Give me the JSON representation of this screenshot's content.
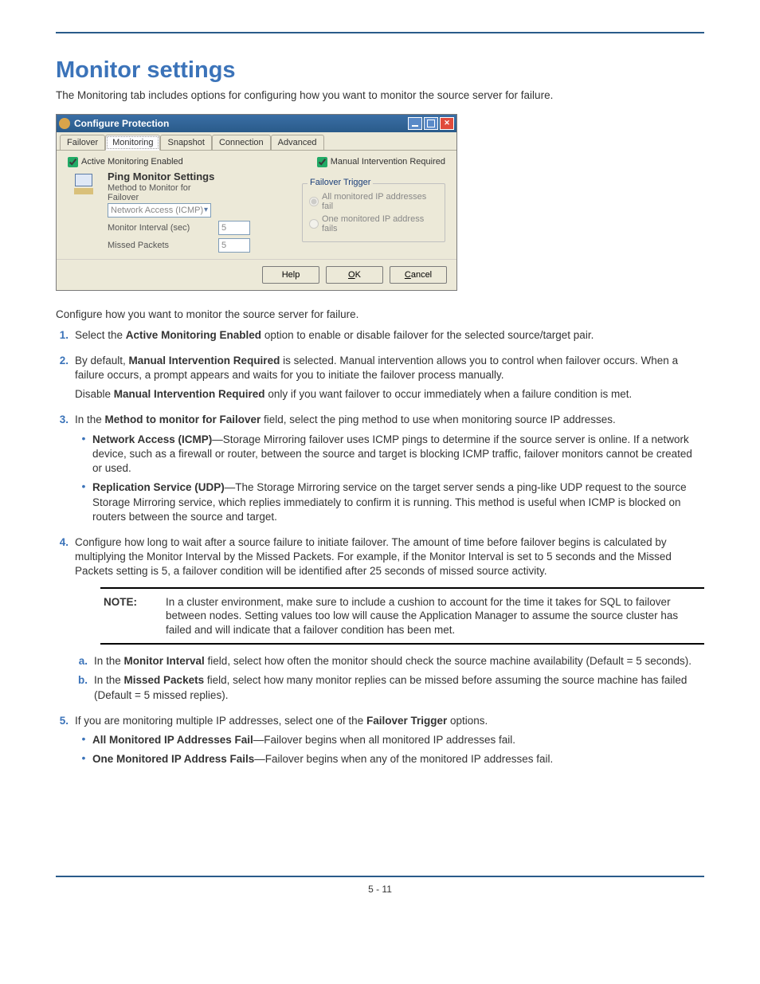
{
  "title": "Monitor settings",
  "intro": "The Monitoring tab includes options for configuring how you want to monitor the source server for failure.",
  "dialog": {
    "title": "Configure Protection",
    "tabs": [
      "Failover",
      "Monitoring",
      "Snapshot",
      "Connection",
      "Advanced"
    ],
    "active_tab": 1,
    "chk_active": "Active Monitoring Enabled",
    "chk_manual": "Manual Intervention Required",
    "ping_title": "Ping Monitor Settings",
    "method_label": "Method to Monitor for Failover",
    "method_value": "Network Access (ICMP)",
    "interval_label": "Monitor Interval (sec)",
    "interval_value": "5",
    "missed_label": "Missed Packets",
    "missed_value": "5",
    "trigger_title": "Failover Trigger",
    "radio_all": "All monitored IP addresses fail",
    "radio_one": "One monitored IP address fails",
    "btn_help": "Help",
    "btn_ok": "OK",
    "btn_cancel": "Cancel"
  },
  "lead": "Configure how you want to monitor the source server for failure.",
  "steps": {
    "s1a": "Select the ",
    "s1b": "Active Monitoring Enabled",
    "s1c": " option to enable or disable failover for the selected source/target pair.",
    "s2a": "By default, ",
    "s2b": "Manual Intervention Required",
    "s2c": " is selected. Manual intervention allows you to control when failover occurs. When a failure occurs, a prompt appears and waits for you to initiate the failover process manually.",
    "s2d": "Disable ",
    "s2e": "Manual Intervention Required",
    "s2f": " only if you want failover to occur immediately when a failure condition is met.",
    "s3a": "In the ",
    "s3b": "Method to monitor for Failover",
    "s3c": " field, select the ping method to use when monitoring source IP addresses.",
    "b1a": "Network Access (ICMP)",
    "b1b": "—Storage Mirroring failover uses ICMP pings to determine if the source server is online. If a network device, such as a firewall or router, between the source and target is blocking ICMP traffic, failover monitors cannot be created or used.",
    "b2a": "Replication Service (UDP)",
    "b2b": "—The Storage Mirroring service on the target server sends a ping-like UDP request to the source Storage Mirroring service, which replies immediately to confirm it is running. This method is useful when ICMP is blocked on routers between the source and target.",
    "s4": "Configure how long to wait after a source failure to initiate failover. The amount of time before failover begins is calculated by multiplying the Monitor Interval by the Missed Packets. For example, if the Monitor Interval is set to 5 seconds and the Missed Packets setting is 5, a failover condition will be identified after 25 seconds of missed source activity.",
    "note_label": "NOTE:",
    "note_body": "In a cluster environment, make sure to include a cushion to account for the time it takes for SQL to failover between nodes. Setting values too low will cause the Application Manager to assume the source cluster has failed and will indicate that a failover condition has been met.",
    "a1a": "In the ",
    "a1b": "Monitor Interval",
    "a1c": " field, select how often the monitor should check the source machine availability (Default = 5 seconds).",
    "a2a": "In the ",
    "a2b": "Missed Packets",
    "a2c": " field, select how many monitor replies can be missed before assuming the source machine has failed (Default = 5 missed replies).",
    "s5a": "If you are monitoring multiple IP addresses, select one of the ",
    "s5b": "Failover Trigger",
    "s5c": " options.",
    "b3a": "All Monitored IP Addresses Fail",
    "b3b": "—Failover begins when all monitored IP addresses fail.",
    "b4a": "One Monitored IP Address Fails",
    "b4b": "—Failover begins when any of the monitored IP addresses fail."
  },
  "footer": "5 - 11"
}
